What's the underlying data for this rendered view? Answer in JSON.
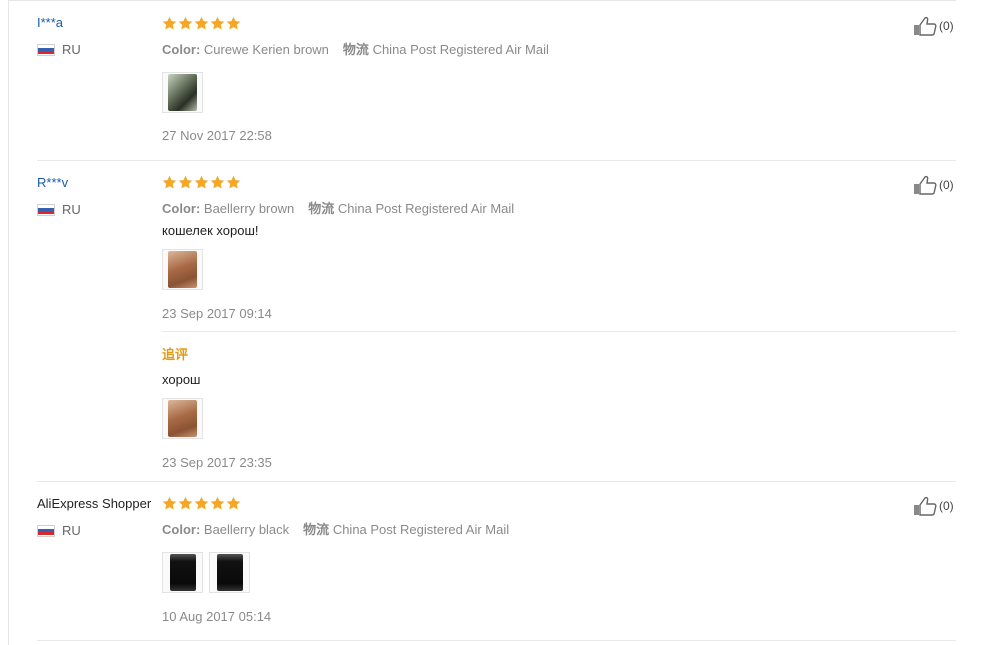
{
  "labels": {
    "color": "Color:",
    "shipping": "物流",
    "followup": "追评"
  },
  "reviews": [
    {
      "user": "I***a",
      "country": "RU",
      "rating": 5,
      "color_value": "Curewe Kerien brown",
      "shipping_value": "China Post Registered Air Mail",
      "images": [
        "green"
      ],
      "date": "27 Nov 2017 22:58",
      "helpful": "(0)"
    },
    {
      "user": "R***v",
      "country": "RU",
      "rating": 5,
      "color_value": "Baellerry brown",
      "shipping_value": "China Post Registered Air Mail",
      "text": "кошелек хорош!",
      "images": [
        "tan"
      ],
      "date": "23 Sep 2017 09:14",
      "helpful": "(0)",
      "followup": {
        "text": "хорош",
        "images": [
          "tan"
        ],
        "date": "23 Sep 2017 23:35"
      }
    },
    {
      "user": "AliExpress Shopper",
      "country": "RU",
      "rating": 5,
      "color_value": "Baellerry black",
      "shipping_value": "China Post Registered Air Mail",
      "images": [
        "black",
        "black"
      ],
      "date": "10 Aug 2017 05:14",
      "helpful": "(0)"
    }
  ],
  "colors": {
    "star": "#f5a623",
    "username_link": "#1a5aa8",
    "followup_label": "#e09a1a"
  },
  "icons": {
    "star": "star-icon",
    "thumb": "thumbs-up-icon",
    "flag": "russia-flag-icon"
  }
}
